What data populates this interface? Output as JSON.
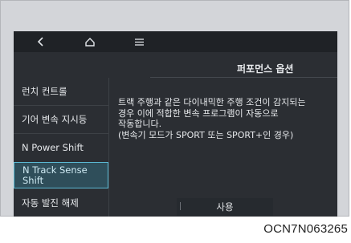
{
  "topbar": {
    "back_icon": "chevron-left-icon",
    "home_icon": "home-icon",
    "menu_icon": "menu-icon"
  },
  "title": "퍼포먼스 옵션",
  "sidebar": {
    "items": [
      {
        "label": "런치 컨트롤",
        "selected": false
      },
      {
        "label": "기어 변속 지시등",
        "selected": false
      },
      {
        "label": "N Power Shift",
        "selected": false
      },
      {
        "label": "N Track Sense Shift",
        "selected": true
      },
      {
        "label": "자동 발진 해제",
        "selected": false
      }
    ]
  },
  "description": {
    "lines": [
      "트랙 주행과 같은 다이내믹한 주행 조건이 감지되는",
      "경우 이에 적합한 변속 프로그램이 자동으로",
      "작동합니다.",
      "(변속기 모드가 SPORT 또는 SPORT+인 경우)"
    ]
  },
  "use_button": "사용",
  "image_code": "OCN7N063265",
  "colors": {
    "screen_bg": "#2b2e33",
    "selected_bg": "#2f4e5a",
    "selected_border": "#5bb9d3"
  }
}
